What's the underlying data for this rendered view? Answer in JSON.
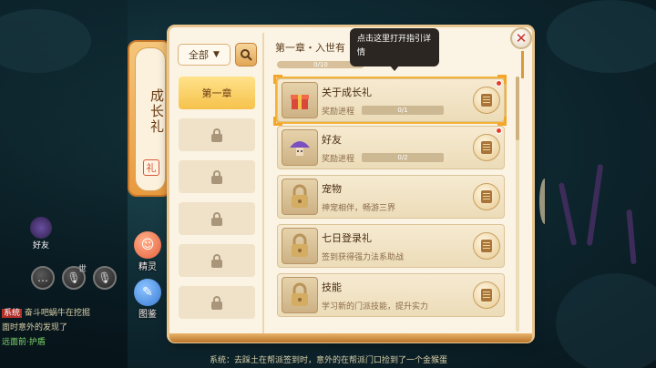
{
  "side_tab": {
    "label": "成长礼",
    "badge_icon": "gift-icon"
  },
  "side_buttons": [
    {
      "label": "精灵",
      "icon": "sprite-avatar-icon",
      "color": "#e6603c"
    },
    {
      "label": "图鉴",
      "icon": "handbook-icon",
      "color": "#3a7bd5"
    }
  ],
  "left_ui": {
    "friends_label": "好友",
    "voice_world_label": "世",
    "chat": [
      {
        "tag": "系统",
        "text": "奋斗吧蜗牛在挖掘"
      },
      {
        "tag": "",
        "text": "面时意外的发现了"
      },
      {
        "tag": "",
        "text": "远面前·护盾"
      }
    ]
  },
  "filter": {
    "label": "全部",
    "search_icon": "search-icon"
  },
  "chapters": [
    {
      "label": "第一章",
      "locked": false
    },
    {
      "label": "",
      "locked": true
    },
    {
      "label": "",
      "locked": true
    },
    {
      "label": "",
      "locked": true
    },
    {
      "label": "",
      "locked": true
    },
    {
      "label": "",
      "locked": true
    }
  ],
  "chapter_header": {
    "title": "第一章・入世有",
    "progress_text": "0/10"
  },
  "tooltip": {
    "text": "点击这里打开指引详情"
  },
  "quests": [
    {
      "name": "关于成长礼",
      "subtitle": "奖励进程",
      "progress_text": "0/1",
      "has_bar": true,
      "icon": "gift-box-icon",
      "highlight": true
    },
    {
      "name": "好友",
      "subtitle": "奖励进程",
      "progress_text": "0/2",
      "has_bar": true,
      "icon": "mushroom-friend-icon",
      "highlight": false
    },
    {
      "name": "宠物",
      "subtitle": "神宠相伴，畅游三界",
      "progress_text": "",
      "has_bar": false,
      "icon": "lock-icon",
      "highlight": false
    },
    {
      "name": "七日登录礼",
      "subtitle": "签到获得强力法系助战",
      "progress_text": "",
      "has_bar": false,
      "icon": "lock-icon",
      "highlight": false
    },
    {
      "name": "技能",
      "subtitle": "学习新的门派技能，提升实力",
      "progress_text": "",
      "has_bar": false,
      "icon": "lock-icon",
      "highlight": false
    }
  ],
  "footer": {
    "text": "系统：去踩土在帮派签到时，意外的在帮派门口捡到了一个金猴蛋"
  },
  "colors": {
    "accent": "#f6c24c",
    "panel": "#fbf4e4",
    "close": "#c8302a"
  }
}
